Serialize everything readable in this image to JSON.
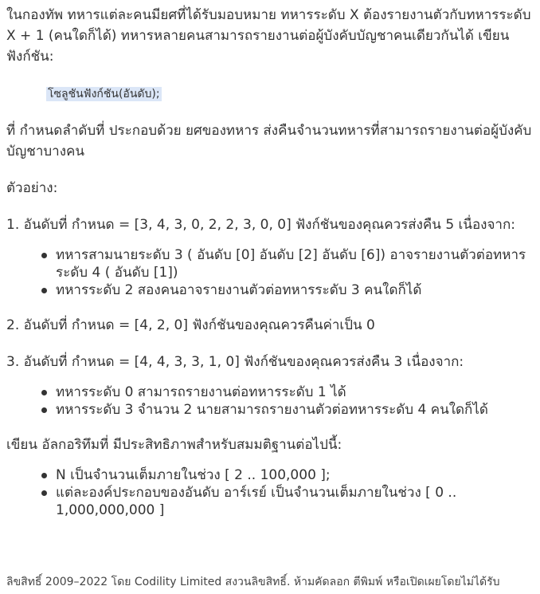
{
  "intro": "ในกองทัพ ทหารแต่ละคนมียศที่ได้รับมอบหมาย ทหารระดับ X ต้องรายงานตัวกับทหารระดับ X + 1 (คนใดก็ได้) ทหารหลายคนสามารถรายงานต่อผู้บังคับบัญชาคนเดียวกันได้ เขียนฟังก์ชัน:",
  "code": "โซลูชันฟังก์ชัน(อันดับ);",
  "description": "ที่ กำหนดลำดับที่ ประกอบด้วย ยศของทหาร ส่งคืนจำนวนทหารที่สามารถรายงานต่อผู้บังคับบัญชาบางคน",
  "examples_heading": "ตัวอย่าง:",
  "example1": {
    "text": "1. อันดับที่ กำหนด = [3, 4, 3, 0, 2, 2, 3, 0, 0] ฟังก์ชันของคุณควรส่งคืน 5 เนื่องจาก:",
    "bullets": [
      "ทหารสามนายระดับ 3 ( อันดับ [0] อันดับ [2] อันดับ [6]) อาจรายงานตัวต่อทหารระดับ 4 ( อันดับ [1])",
      "ทหารระดับ 2 สองคนอาจรายงานตัวต่อทหารระดับ 3 คนใดก็ได้"
    ]
  },
  "example2": {
    "text": "2. อันดับที่ กำหนด = [4, 2, 0] ฟังก์ชันของคุณควรคืนค่าเป็น 0"
  },
  "example3": {
    "text": "3. อันดับที่ กำหนด = [4, 4, 3, 3, 1, 0] ฟังก์ชันของคุณควรส่งคืน 3 เนื่องจาก:",
    "bullets": [
      "ทหารระดับ 0 สามารถรายงานต่อทหารระดับ 1 ได้",
      "ทหารระดับ 3 จำนวน 2 นายสามารถรายงานตัวต่อทหารระดับ 4 คนใดก็ได้"
    ]
  },
  "assumptions_heading": "เขียน อัลกอริทึมที่ มีประสิทธิภาพสำหรับสมมติฐานต่อไปนี้:",
  "assumptions": [
    "N เป็นจำนวนเต็มภายในช่วง [ 2 .. 100,000 ];",
    "แต่ละองค์ประกอบของอันดับ อาร์เรย์ เป็นจำนวนเต็มภายในช่วง [ 0 .. 1,000,000,000 ]"
  ],
  "footer": "ลิขสิทธิ์ 2009–2022 โดย Codility Limited สงวนลิขสิทธิ์. ห้ามคัดลอก ตีพิมพ์ หรือเปิดเผยโดยไม่ได้รับ"
}
